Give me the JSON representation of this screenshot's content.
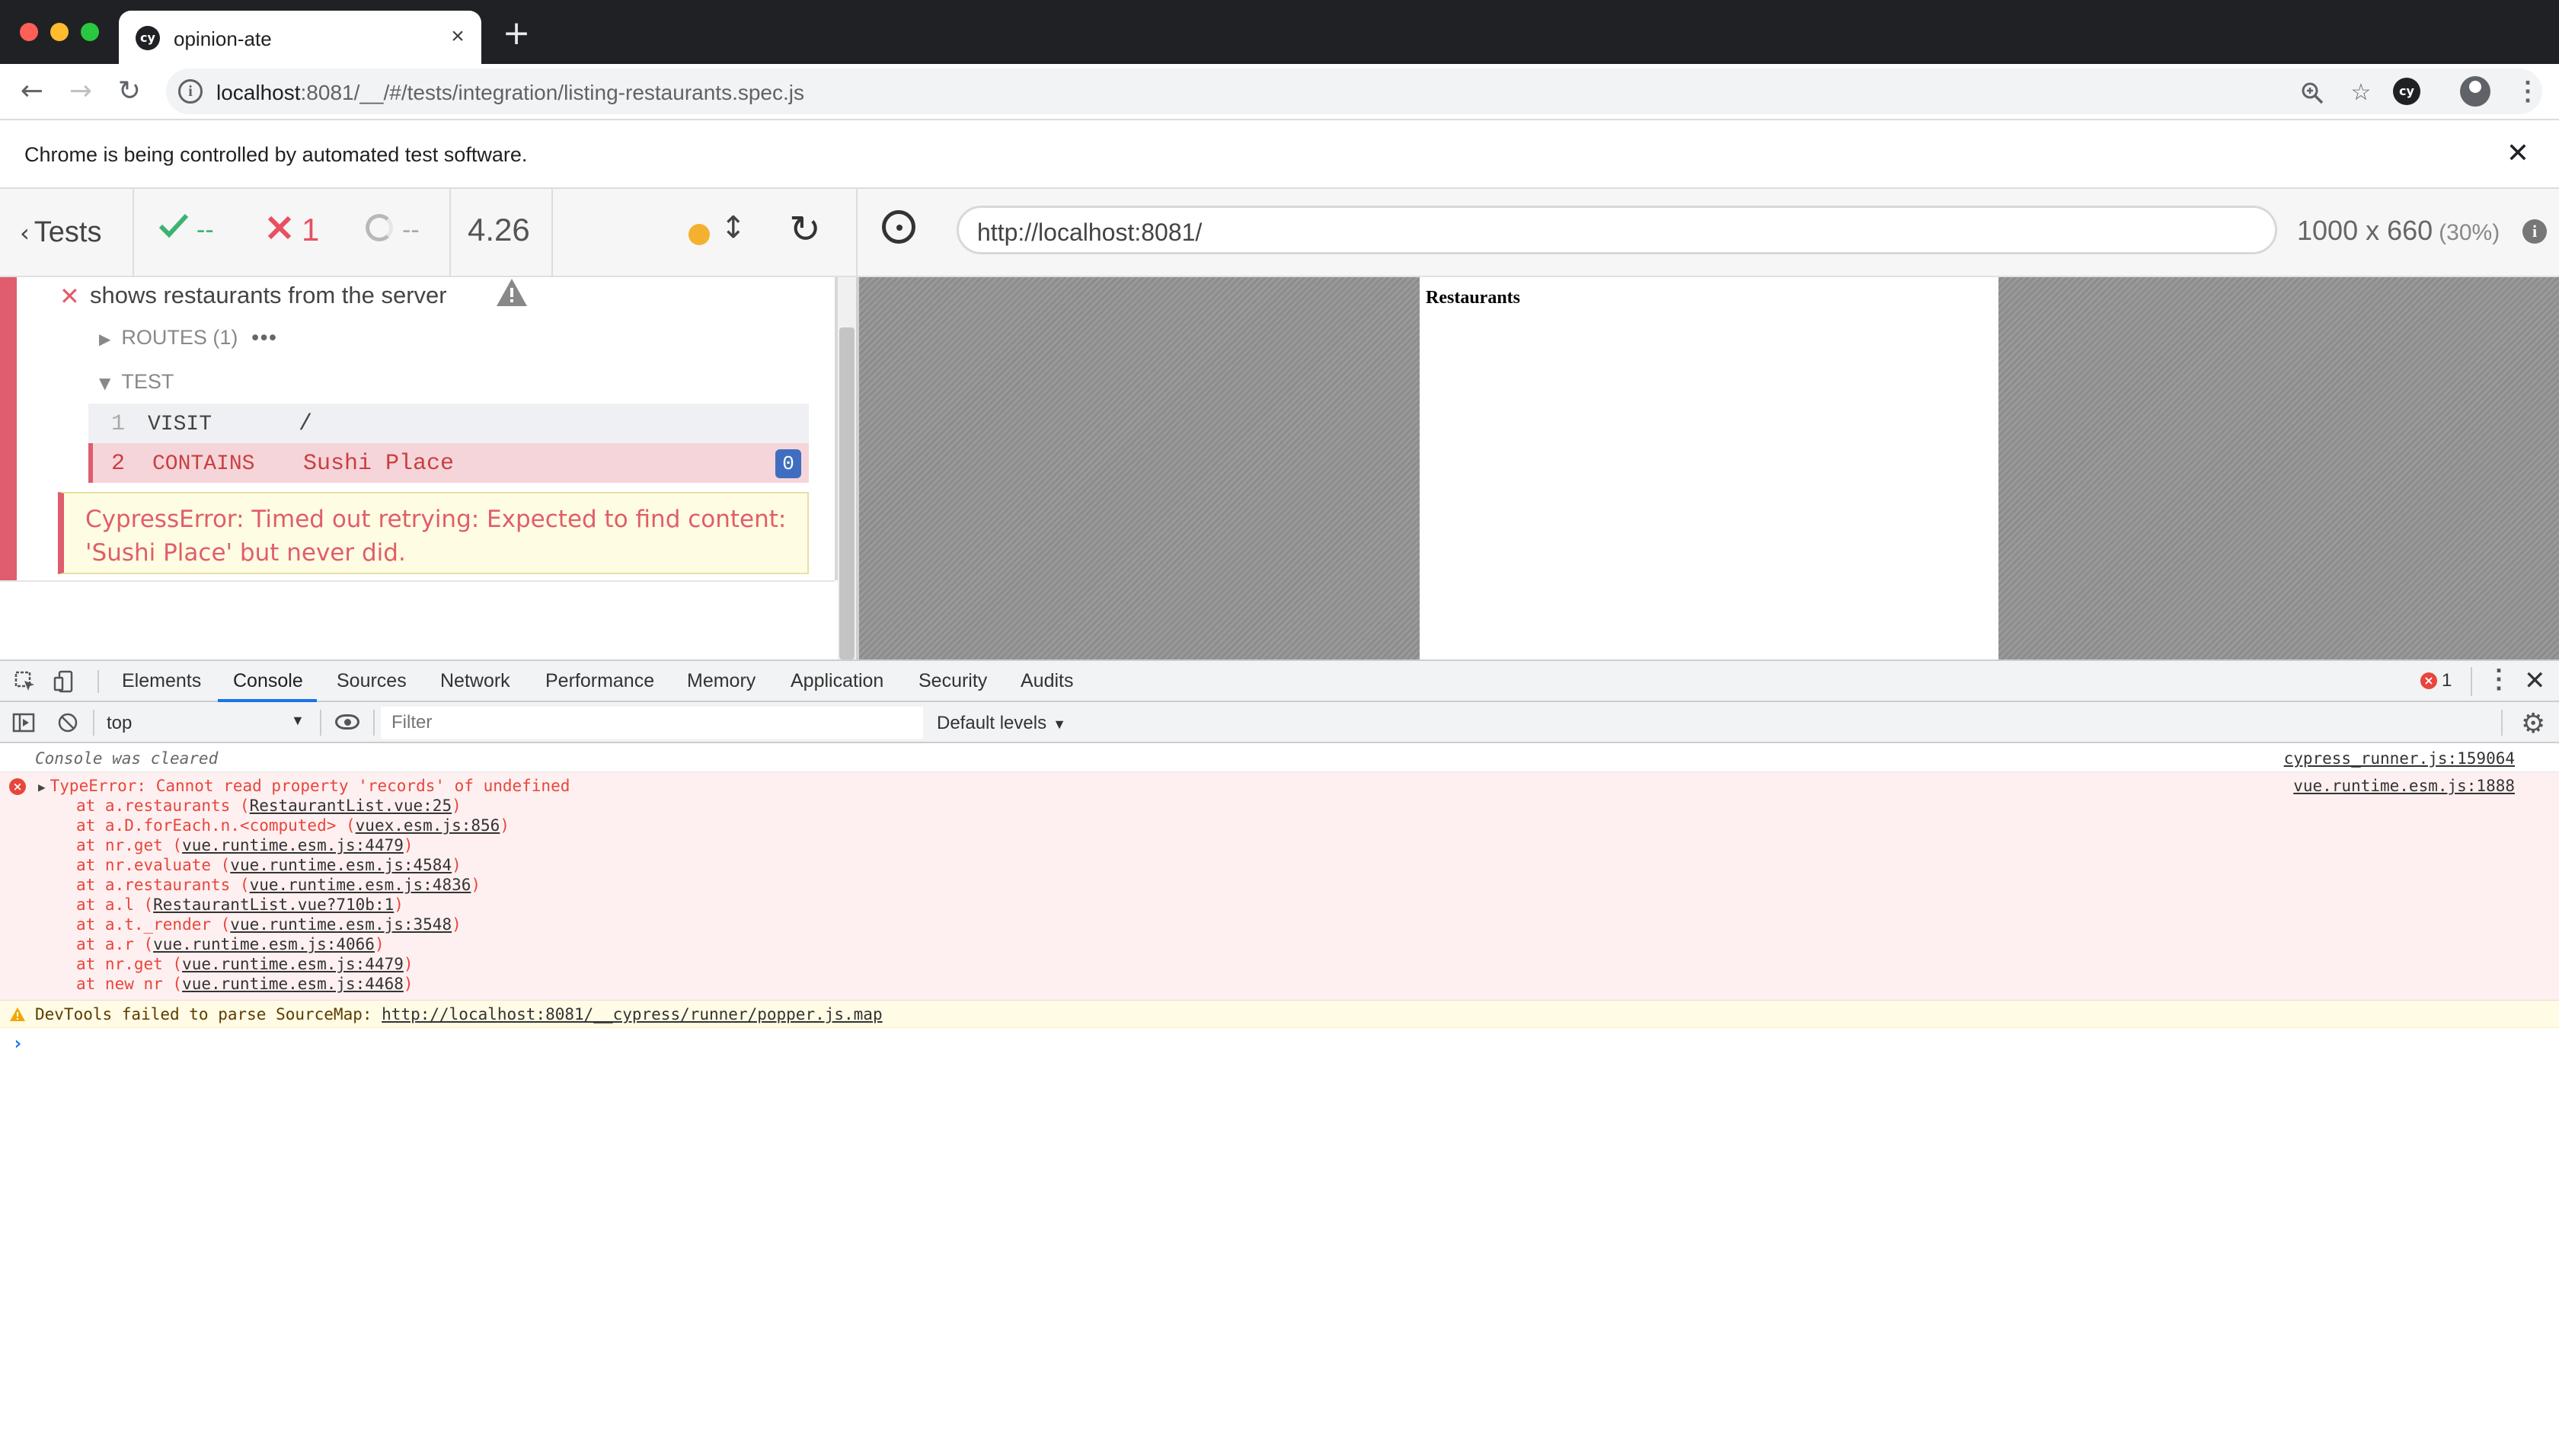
{
  "browser": {
    "tab_title": "opinion-ate",
    "tab_favicon": "cy",
    "url_host": "localhost",
    "url_path": ":8081/__/#/tests/integration/listing-restaurants.spec.js",
    "extension_label": "cy",
    "infobar_text": "Chrome is being controlled by automated test software.",
    "icons": [
      "back-icon",
      "forward-icon",
      "reload-icon",
      "info-icon",
      "zoom-icon",
      "star-icon",
      "profile-icon",
      "menu-icon"
    ]
  },
  "runner": {
    "tests_label": "Tests",
    "passed": "--",
    "failed": "1",
    "pending": "--",
    "duration": "4.26",
    "aut_url": "http://localhost:8081/",
    "viewport_size": "1000 x 660",
    "viewport_scale": "(30%)",
    "colors": {
      "pass": "#3cb371",
      "fail": "#e05d6d",
      "running": "#f4b12f"
    }
  },
  "reporter": {
    "test_title": "shows restaurants from the server",
    "routes_label": "ROUTES (1)",
    "test_label": "TEST",
    "commands": [
      {
        "num": "1",
        "name": "VISIT",
        "message": "/"
      },
      {
        "num": "2",
        "name": "CONTAINS",
        "message": "Sushi Place",
        "badge": "0"
      }
    ],
    "error_text": "CypressError: Timed out retrying: Expected to find content: 'Sushi Place' but never did."
  },
  "aut": {
    "heading": "Restaurants"
  },
  "devtools": {
    "tabs": [
      "Elements",
      "Console",
      "Sources",
      "Network",
      "Performance",
      "Memory",
      "Application",
      "Security",
      "Audits"
    ],
    "active_tab": "Console",
    "error_count": "1",
    "context": "top",
    "filter_placeholder": "Filter",
    "levels": "Default levels",
    "console": {
      "cleared_text": "Console was cleared",
      "cleared_source": "cypress_runner.js:159064",
      "error_head": "TypeError: Cannot read property 'records' of undefined",
      "error_source": "vue.runtime.esm.js:1888",
      "stack": [
        {
          "fn": "at a.restaurants (",
          "link": "RestaurantList.vue:25",
          "end": ")"
        },
        {
          "fn": "at a.D.forEach.n.<computed> (",
          "link": "vuex.esm.js:856",
          "end": ")"
        },
        {
          "fn": "at nr.get (",
          "link": "vue.runtime.esm.js:4479",
          "end": ")"
        },
        {
          "fn": "at nr.evaluate (",
          "link": "vue.runtime.esm.js:4584",
          "end": ")"
        },
        {
          "fn": "at a.restaurants (",
          "link": "vue.runtime.esm.js:4836",
          "end": ")"
        },
        {
          "fn": "at a.l (",
          "link": "RestaurantList.vue?710b:1",
          "end": ")"
        },
        {
          "fn": "at a.t._render (",
          "link": "vue.runtime.esm.js:3548",
          "end": ")"
        },
        {
          "fn": "at a.r (",
          "link": "vue.runtime.esm.js:4066",
          "end": ")"
        },
        {
          "fn": "at nr.get (",
          "link": "vue.runtime.esm.js:4479",
          "end": ")"
        },
        {
          "fn": "at new nr (",
          "link": "vue.runtime.esm.js:4468",
          "end": ")"
        }
      ],
      "warning_text": "DevTools failed to parse SourceMap: ",
      "warning_link": "http://localhost:8081/__cypress/runner/popper.js.map"
    }
  }
}
